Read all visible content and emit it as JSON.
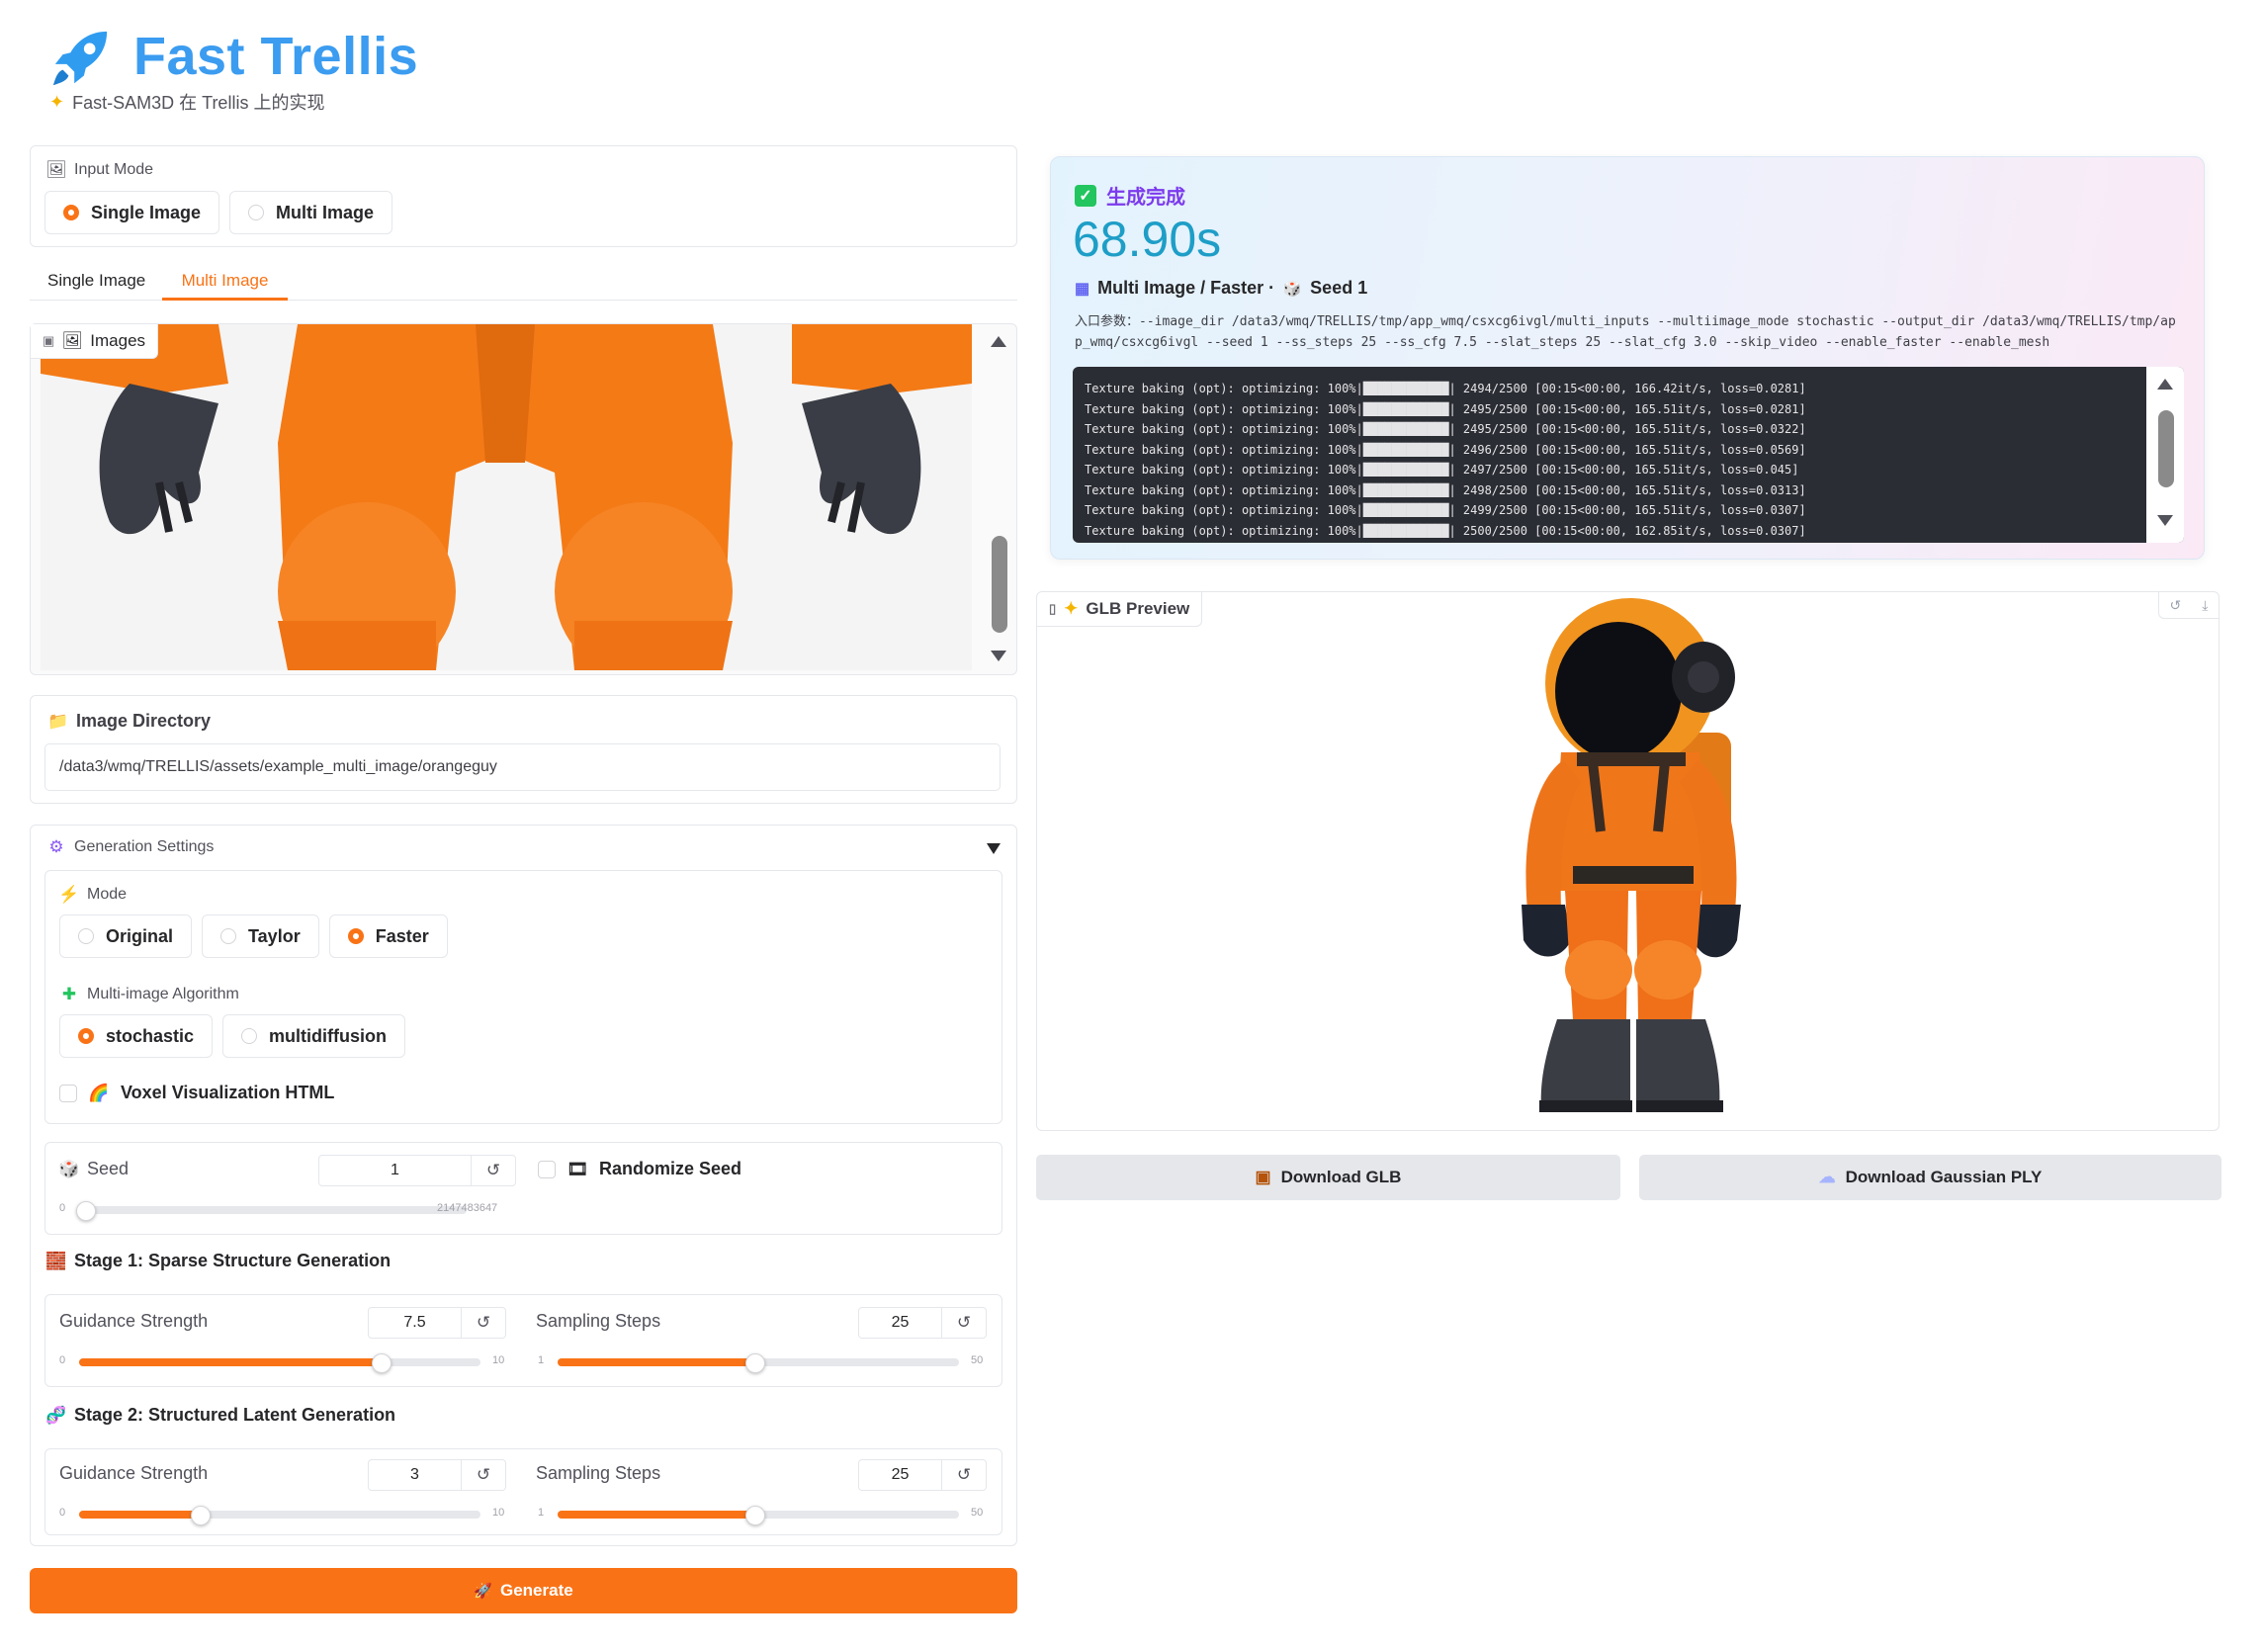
{
  "header": {
    "title": "Fast Trellis",
    "subtitle": "Fast-SAM3D 在 Trellis 上的实现"
  },
  "input_mode": {
    "label": "Input Mode",
    "options": [
      "Single Image",
      "Multi Image"
    ],
    "selected": "Single Image"
  },
  "tabs": {
    "items": [
      "Single Image",
      "Multi Image"
    ],
    "active": "Multi Image"
  },
  "images": {
    "label": "Images"
  },
  "image_dir": {
    "label": "Image Directory",
    "value": "/data3/wmq/TRELLIS/assets/example_multi_image/orangeguy"
  },
  "gen_settings": {
    "label": "Generation Settings",
    "mode_label": "Mode",
    "modes": [
      "Original",
      "Taylor",
      "Faster"
    ],
    "mode_selected": "Faster",
    "algo_label": "Multi-image Algorithm",
    "algos": [
      "stochastic",
      "multidiffusion"
    ],
    "algo_selected": "stochastic",
    "voxel_label": "Voxel Visualization HTML",
    "voxel_checked": false
  },
  "seed": {
    "label": "Seed",
    "value": "1",
    "min": "0",
    "max": "2147483647",
    "fraction": 0.0,
    "randomize_label": "Randomize Seed",
    "randomize_checked": false
  },
  "stage1": {
    "title": "Stage 1: Sparse Structure Generation",
    "guidance": {
      "label": "Guidance Strength",
      "value": "7.5",
      "min": "0",
      "max": "10",
      "fraction": 0.75
    },
    "steps": {
      "label": "Sampling Steps",
      "value": "25",
      "min": "1",
      "max": "50",
      "fraction": 0.49
    }
  },
  "stage2": {
    "title": "Stage 2: Structured Latent Generation",
    "guidance": {
      "label": "Guidance Strength",
      "value": "3",
      "min": "0",
      "max": "10",
      "fraction": 0.3
    },
    "steps": {
      "label": "Sampling Steps",
      "value": "25",
      "min": "1",
      "max": "50",
      "fraction": 0.49
    }
  },
  "generate_label": "Generate",
  "result": {
    "status": "生成完成",
    "time": "68.90s",
    "meta_mode": "Multi Image / Faster ·",
    "meta_seed": "Seed 1",
    "args": "入口参数：--image_dir /data3/wmq/TRELLIS/tmp/app_wmq/csxcg6ivgl/multi_inputs --multiimage_mode stochastic --output_dir /data3/wmq/TRELLIS/tmp/app_wmq/csxcg6ivgl --seed 1 --ss_steps 25 --ss_cfg 7.5 --slat_steps 25 --slat_cfg 3.0 --skip_video --enable_faster --enable_mesh",
    "log_lines": [
      "Texture baking (opt): optimizing: 100%|████████████| 2494/2500 [00:15<00:00, 166.42it/s, loss=0.0281]",
      "Texture baking (opt): optimizing: 100%|████████████| 2495/2500 [00:15<00:00, 165.51it/s, loss=0.0281]",
      "Texture baking (opt): optimizing: 100%|████████████| 2495/2500 [00:15<00:00, 165.51it/s, loss=0.0322]",
      "Texture baking (opt): optimizing: 100%|████████████| 2496/2500 [00:15<00:00, 165.51it/s, loss=0.0569]",
      "Texture baking (opt): optimizing: 100%|████████████| 2497/2500 [00:15<00:00, 165.51it/s, loss=0.045]",
      "Texture baking (opt): optimizing: 100%|████████████| 2498/2500 [00:15<00:00, 165.51it/s, loss=0.0313]",
      "Texture baking (opt): optimizing: 100%|████████████| 2499/2500 [00:15<00:00, 165.51it/s, loss=0.0307]",
      "Texture baking (opt): optimizing: 100%|████████████| 2500/2500 [00:15<00:00, 162.85it/s, loss=0.0307]"
    ]
  },
  "glb": {
    "label": "GLB Preview"
  },
  "downloads": {
    "glb": "Download GLB",
    "ply": "Download Gaussian PLY"
  },
  "icons": {
    "logo": "rocket-icon",
    "sparkle": "sparkle-icon",
    "picture": "picture-icon",
    "folder": "folder-icon",
    "gear": "gear-icon",
    "lightning": "lightning-icon",
    "puzzle": "puzzle-icon",
    "rainbow": "rainbow-icon",
    "dice": "dice-icon",
    "film": "film-icon",
    "bricks": "bricks-icon",
    "dna": "dna-icon",
    "check": "check-icon",
    "grid": "grid-icon",
    "box": "box-icon",
    "cloud": "cloud-icon"
  },
  "colors": {
    "accent": "#f97316",
    "title_blue": "#3b9cf0",
    "status_purple": "#7c3aed",
    "time_teal": "#1e9ec7"
  }
}
